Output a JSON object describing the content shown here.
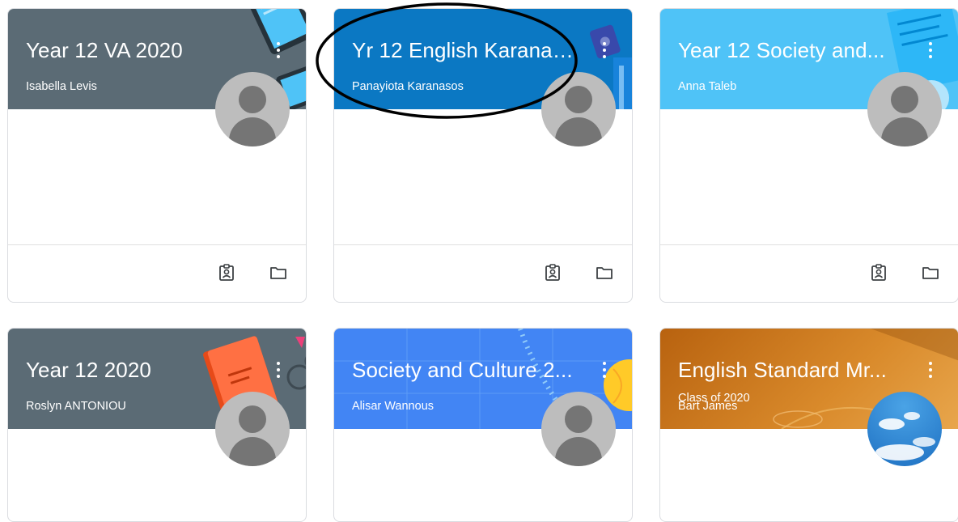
{
  "classes": [
    {
      "title": "Year 12 VA 2020",
      "section": "",
      "teacher": "Isabella Levis",
      "banner_color": "#5b6b75",
      "avatar": "default"
    },
    {
      "title": "Yr 12 English Karanas...",
      "section": "",
      "teacher": "Panayiota Karanasos",
      "banner_color": "#0b78c3",
      "avatar": "default"
    },
    {
      "title": "Year 12 Society and...",
      "section": "",
      "teacher": "Anna Taleb",
      "banner_color": "#4fc3f7",
      "avatar": "default"
    },
    {
      "title": "Year 12 2020",
      "section": "",
      "teacher": "Roslyn ANTONIOU",
      "banner_color": "#5b6b75",
      "avatar": "default"
    },
    {
      "title": "Society and Culture 2...",
      "section": "",
      "teacher": "Alisar Wannous",
      "banner_color": "#4285f4",
      "avatar": "default"
    },
    {
      "title": "English Standard Mr...",
      "section": "Class of 2020",
      "teacher": "Bart James",
      "banner_color": "#c97a17",
      "avatar": "sky"
    }
  ],
  "icons": {
    "more": "more-vert-icon",
    "classwork": "assignment-ind-icon",
    "folder": "folder-icon"
  }
}
